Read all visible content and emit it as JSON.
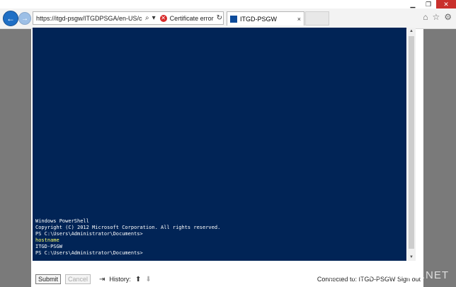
{
  "window": {
    "minimize_glyph": "▁",
    "restore_glyph": "❐",
    "close_glyph": "✕"
  },
  "browser": {
    "back_glyph": "←",
    "forward_glyph": "→",
    "address": "https://itgd-psgw/ITGDPSGA/en-US/console.a",
    "search_glyph": "⌕",
    "dropdown_glyph": "▾",
    "cert_error": "Certificate error",
    "refresh_glyph": "↻",
    "tab_title": "ITGD-PSGW",
    "tab_close": "×",
    "home_glyph": "⌂",
    "favorites_glyph": "☆",
    "tools_glyph": "⚙"
  },
  "console": {
    "lines": [
      {
        "text": "Windows PowerShell",
        "color": "white"
      },
      {
        "text": "Copyright (C) 2012 Microsoft Corporation. All rights reserved.",
        "color": "white"
      },
      {
        "text": "",
        "color": "white"
      },
      {
        "text": "PS C:\\Users\\Administrator\\Documents>",
        "color": "white"
      },
      {
        "text": "hostname",
        "color": "yellow"
      },
      {
        "text": "ITGD-PSGW",
        "color": "white"
      },
      {
        "text": "PS C:\\Users\\Administrator\\Documents>",
        "color": "white"
      }
    ]
  },
  "controls": {
    "submit": "Submit",
    "cancel": "Cancel",
    "enter_glyph": "⇥",
    "history_label": "History:",
    "history_up": "⬆",
    "history_down": "⬇",
    "connection": "Connected to: ITGD-PSGW",
    "sign_out": "Sign out"
  },
  "watermark": "@ITGUYDIARIES.NET",
  "colors": {
    "console_bg": "#012456",
    "highlight": "#ffff66"
  }
}
